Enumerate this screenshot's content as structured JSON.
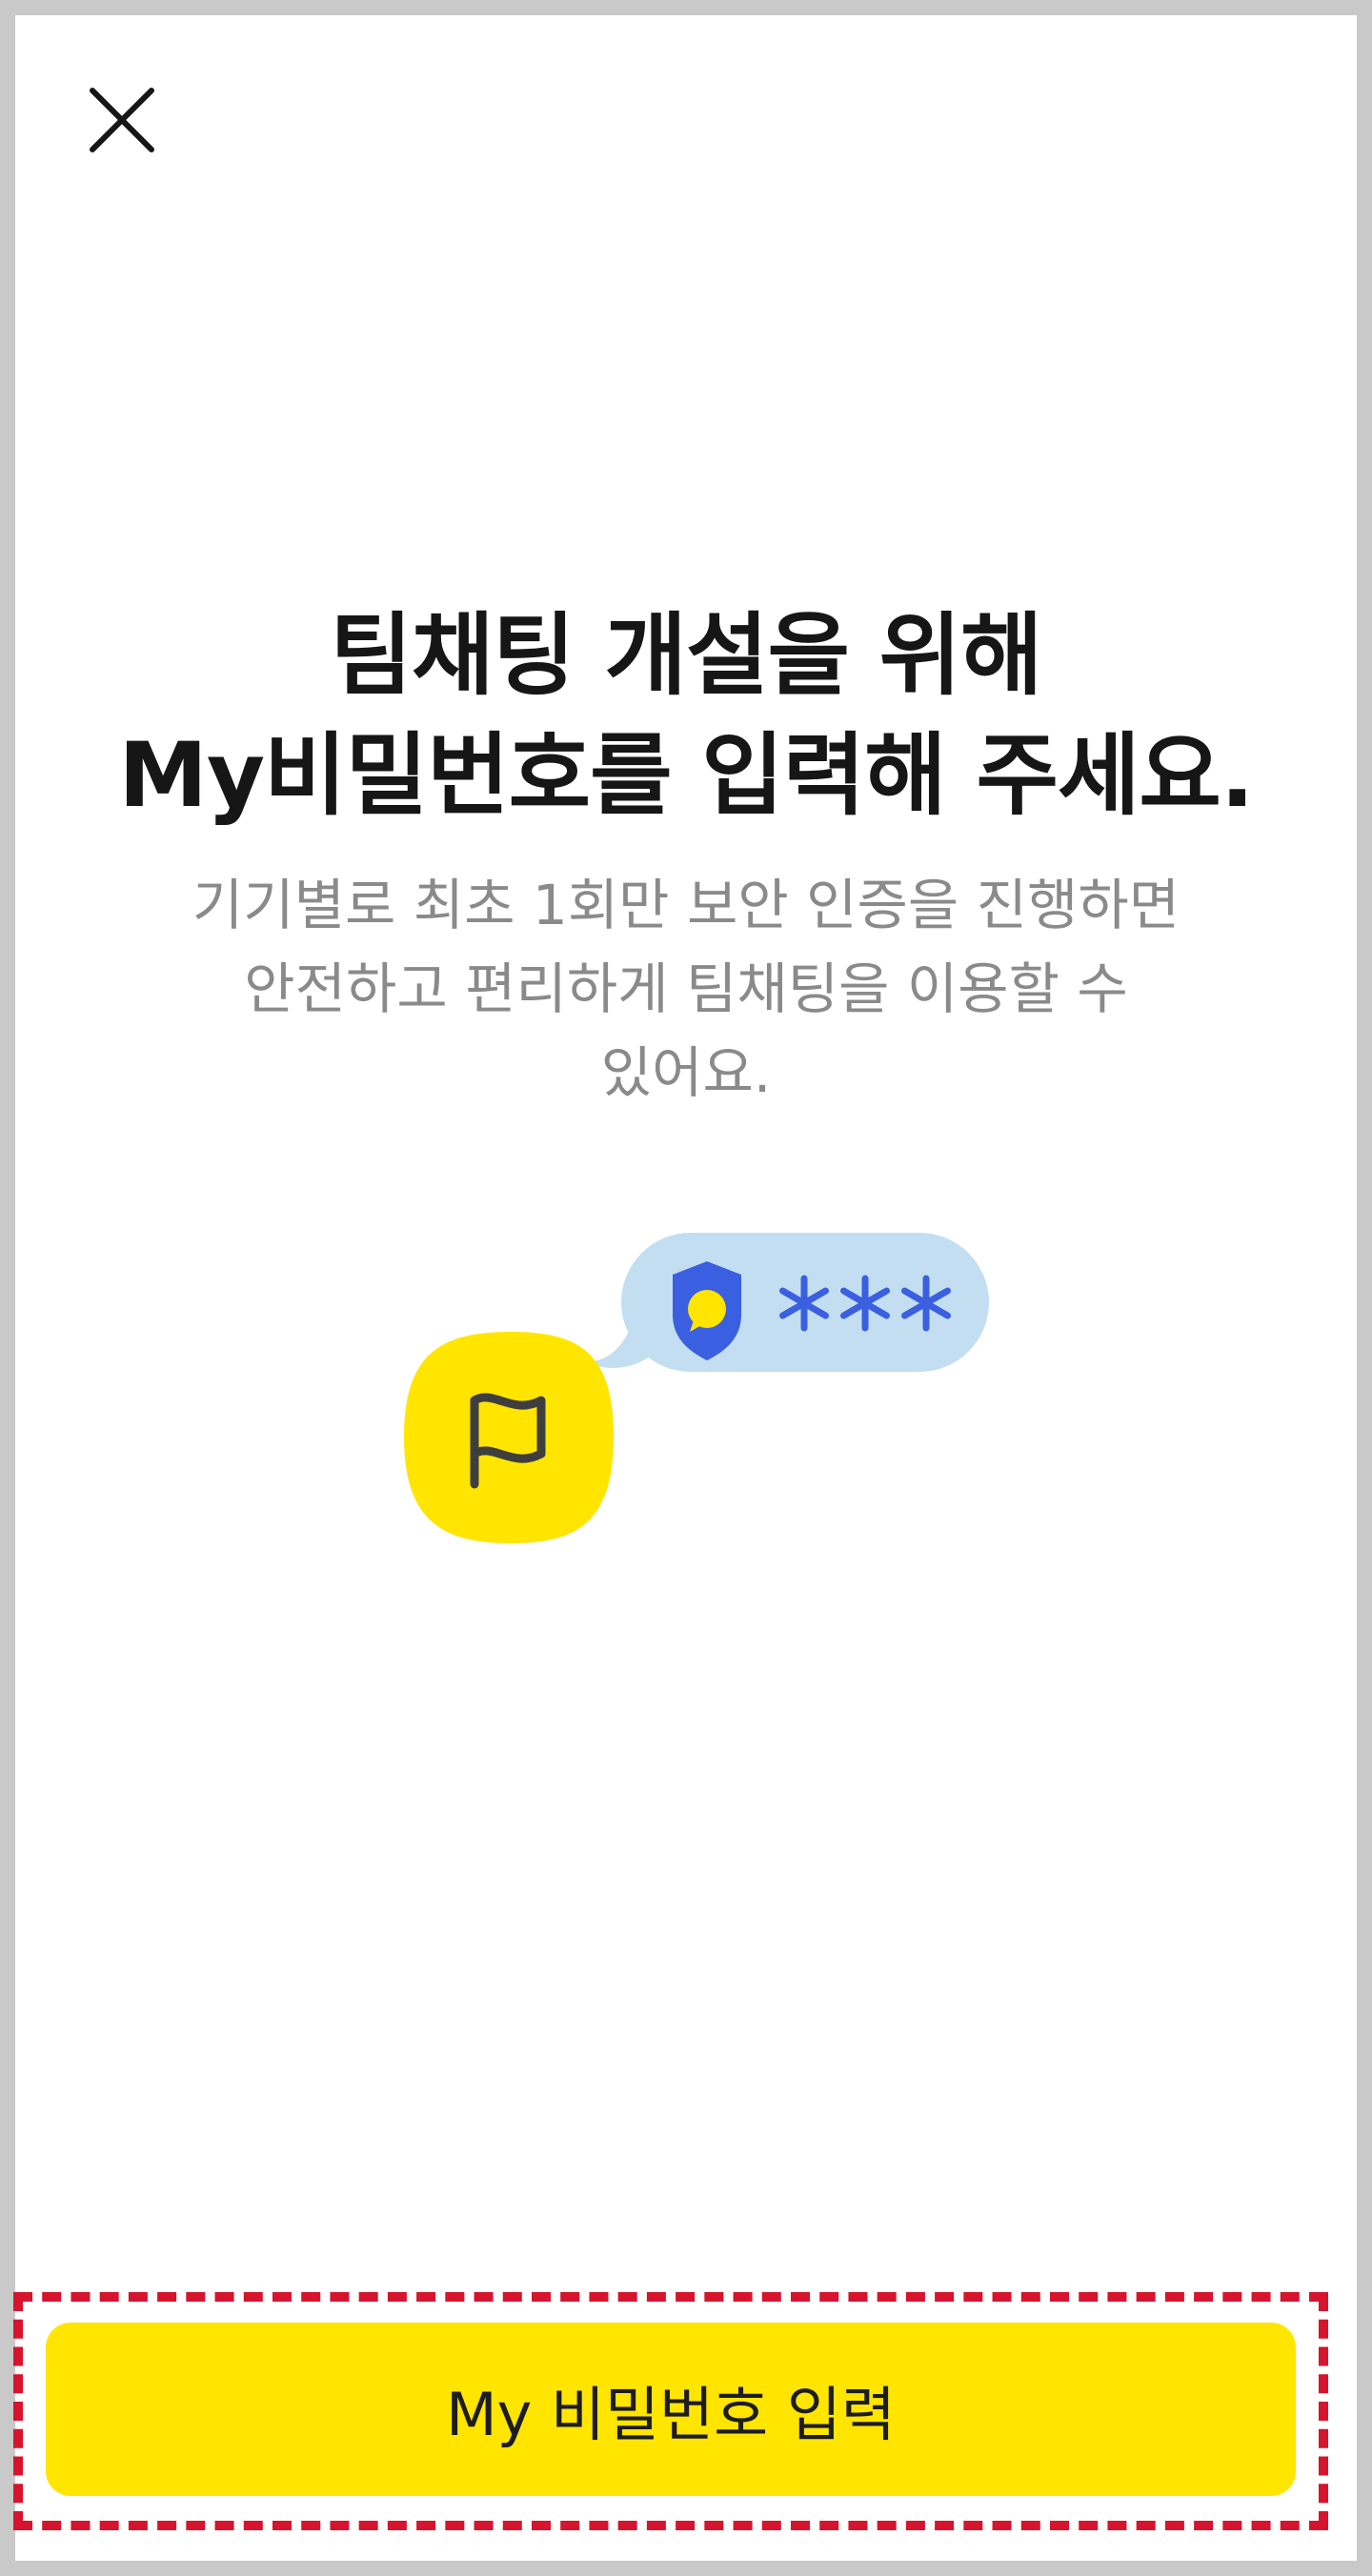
{
  "header": {
    "close_icon": "close-icon"
  },
  "main": {
    "title_line1": "팀채팅 개설을 위해",
    "title_line2": "My비밀번호를 입력해 주세요.",
    "subtitle_line1": "기기별로 최초 1회만 보안 인증을 진행하면",
    "subtitle_line2": "안전하고 편리하게 팀채팅을 이용할 수",
    "subtitle_line3": "있어요."
  },
  "illustration": {
    "flag_icon": "flag-icon",
    "shield_icon": "shield-chat-icon",
    "masked_password": "***",
    "colors": {
      "yellow": "#ffe500",
      "bubble": "#c3def1",
      "blue": "#3a5fe0",
      "dark": "#3e3e3e"
    }
  },
  "footer": {
    "cta_label": "My 비밀번호 입력"
  }
}
